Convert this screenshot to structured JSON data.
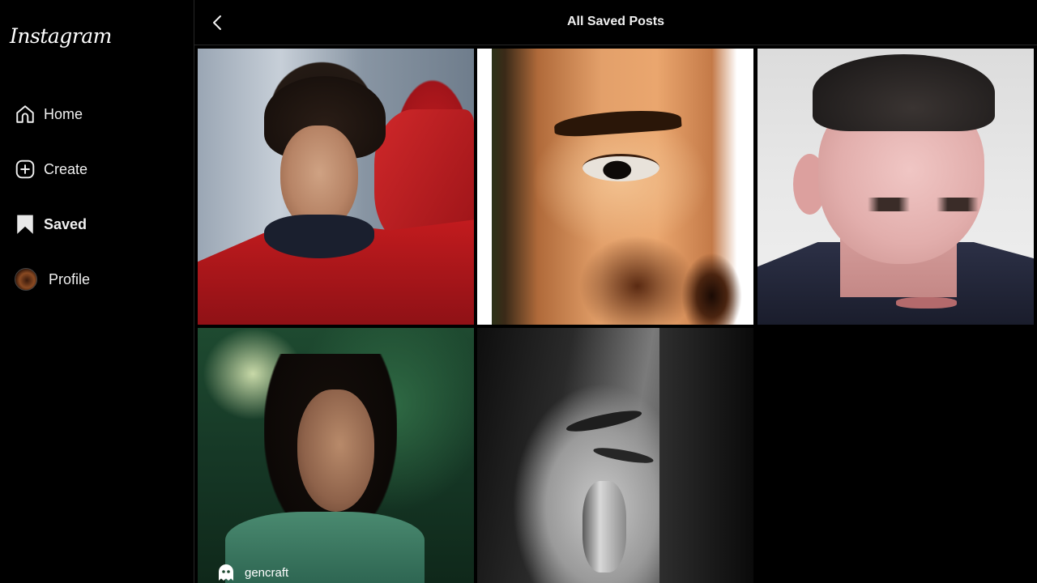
{
  "app": {
    "logo": "Instagram"
  },
  "sidebar": {
    "items": [
      {
        "label": "Home",
        "icon": "home-icon"
      },
      {
        "label": "Create",
        "icon": "plus-square-icon"
      },
      {
        "label": "Saved",
        "icon": "bookmark-icon",
        "active": true
      },
      {
        "label": "Profile",
        "icon": "avatar"
      }
    ]
  },
  "header": {
    "title": "All Saved Posts",
    "back_icon": "chevron-left-icon"
  },
  "posts": [
    {
      "alt": "Young man with curly hair in red hoodie"
    },
    {
      "alt": "Close-up of an eye and eyebrow"
    },
    {
      "alt": "Young man with buzz cut"
    },
    {
      "alt": "Woman in green-lit room",
      "watermark": "gencraft"
    },
    {
      "alt": "Black and white portrait of a man"
    }
  ],
  "colors": {
    "background": "#000000",
    "border": "#262626",
    "text": "#f5f5f5"
  }
}
